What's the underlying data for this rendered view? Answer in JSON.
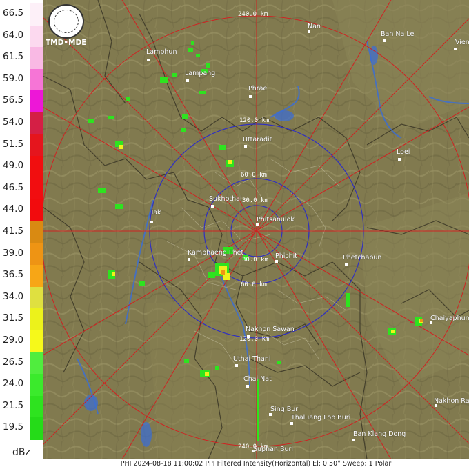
{
  "legend": {
    "unit": "dBz",
    "levels": [
      {
        "label": "66.5",
        "color": "#fdf0f8"
      },
      {
        "label": "64.0",
        "color": "#fcd9ef"
      },
      {
        "label": "61.5",
        "color": "#f9b9e4"
      },
      {
        "label": "59.0",
        "color": "#f675d6"
      },
      {
        "label": "56.5",
        "color": "#ed17d7"
      },
      {
        "label": "54.0",
        "color": "#d41f45"
      },
      {
        "label": "51.5",
        "color": "#e5151d"
      },
      {
        "label": "49.0",
        "color": "#f10e0f"
      },
      {
        "label": "46.5",
        "color": "#f20d10"
      },
      {
        "label": "44.0",
        "color": "#f20b0d"
      },
      {
        "label": "41.5",
        "color": "#d98a12"
      },
      {
        "label": "39.0",
        "color": "#ee9414"
      },
      {
        "label": "36.5",
        "color": "#f7a616"
      },
      {
        "label": "34.0",
        "color": "#dfe040"
      },
      {
        "label": "31.5",
        "color": "#ecf21b"
      },
      {
        "label": "29.0",
        "color": "#f6f91a"
      },
      {
        "label": "26.5",
        "color": "#50ed3e"
      },
      {
        "label": "24.0",
        "color": "#3bea2c"
      },
      {
        "label": "21.5",
        "color": "#2ee31f"
      },
      {
        "label": "19.5",
        "color": "#25db18"
      }
    ]
  },
  "logo": {
    "text": "TMD•MDE"
  },
  "rings": {
    "r30a": "30.0 km",
    "r30b": "30.0 km",
    "r60a": "60.0 km",
    "r60b": "60.0 km",
    "r120a": "120.0 km",
    "r120b": "120.0 km",
    "r240a": "240.0 km",
    "r240b": "240.0 km"
  },
  "cities": {
    "nan": "Nan",
    "ban_na_le": "Ban Na Le",
    "vien": "Vien",
    "lamphun": "Lamphun",
    "lampang": "Lampang",
    "phrae": "Phrae",
    "uttaradit": "Uttaradit",
    "loei": "Loei",
    "sukhothai": "Sukhothai",
    "phitsanulok": "Phitsanulok",
    "tak": "Tak",
    "kamphaeng_phet": "Kamphaeng Phet",
    "phichit": "Phichit",
    "phetchabun": "Phetchabun",
    "chaiyaphum": "Chaiyaphum",
    "nakhon_sawan": "Nakhon Sawan",
    "uthai_thani": "Uthai Thani",
    "chai_nat": "Chai Nat",
    "nakhon_ra": "Nakhon Ra",
    "sing_buri": "Sing Buri",
    "thaluang": "Thaluang Lop Buri",
    "ban_klang_dong": "Ban Klang Dong",
    "suphan": "Suphan Buri"
  },
  "status": "PHI 2024-08-18 11:00:02 PPI Filtered Intensity(Horizontal)  El: 0.50°  Sweep: 1 Polar"
}
